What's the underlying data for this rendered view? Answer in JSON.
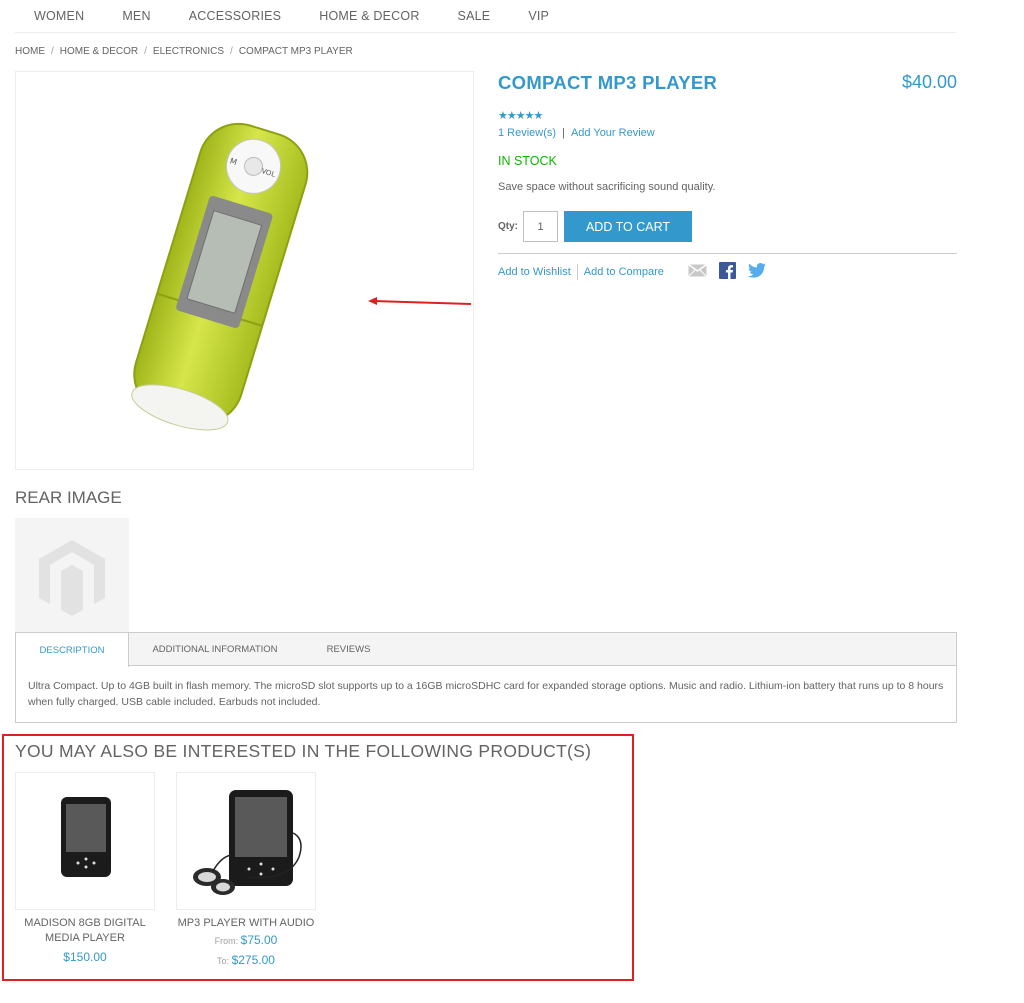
{
  "nav": {
    "items": [
      "WOMEN",
      "MEN",
      "ACCESSORIES",
      "HOME & DECOR",
      "SALE",
      "VIP"
    ]
  },
  "breadcrumb": [
    "HOME",
    "HOME & DECOR",
    "ELECTRONICS",
    "COMPACT MP3 PLAYER"
  ],
  "product": {
    "name": "COMPACT MP3 PLAYER",
    "price": "$40.00",
    "rating_stars": "★★★★★",
    "rating": 5,
    "reviews_link": "1 Review(s)",
    "add_review_link": "Add Your Review",
    "stock": "IN STOCK",
    "short_description": "Save space without sacrificing sound quality.",
    "qty_label": "Qty:",
    "qty_value": "1",
    "add_to_cart": "ADD TO CART",
    "wishlist_link": "Add to Wishlist",
    "compare_link": "Add to Compare",
    "player_labels": {
      "mode": "M",
      "volume": "VOL"
    }
  },
  "rear": {
    "title": "REAR IMAGE"
  },
  "tabs": {
    "items": [
      "DESCRIPTION",
      "ADDITIONAL INFORMATION",
      "REVIEWS"
    ],
    "active": "DESCRIPTION",
    "description": "Ultra Compact. Up to 4GB built in flash memory. The microSD slot supports up to a 16GB microSDHC card for expanded storage options. Music and radio. Lithium-ion battery that runs up to 8 hours when fully charged. USB cable included. Earbuds not included."
  },
  "upsell": {
    "title": "YOU MAY ALSO BE INTERESTED IN THE FOLLOWING PRODUCT(S)",
    "items": [
      {
        "name": "MADISON 8GB DIGITAL MEDIA PLAYER",
        "price": "$150.00"
      },
      {
        "name": "MP3 PLAYER WITH AUDIO",
        "from_label": "From:",
        "from_price": "$75.00",
        "to_label": "To:",
        "to_price": "$275.00"
      }
    ]
  },
  "colors": {
    "accent": "#3399cc",
    "stock": "#11b400",
    "annotation": "#e02020",
    "text": "#636363"
  }
}
